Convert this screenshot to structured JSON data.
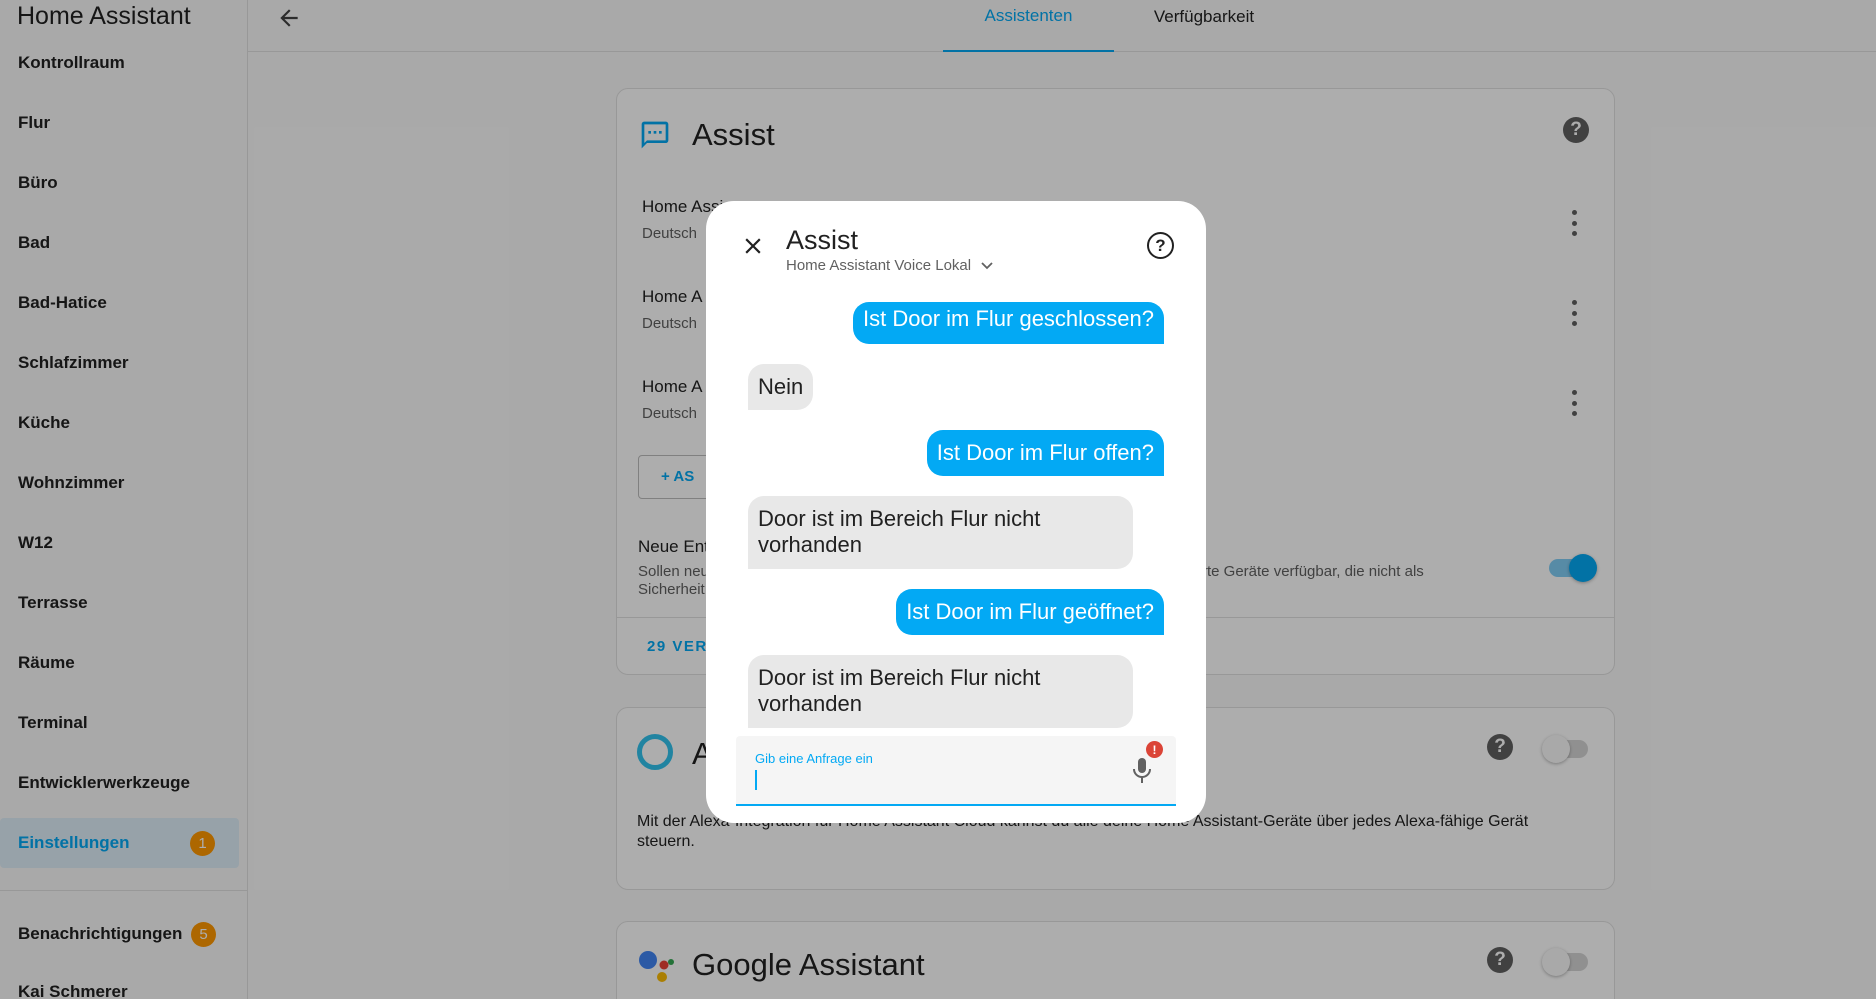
{
  "sidebar": {
    "title": "Home Assistant",
    "items": [
      {
        "label": "Kontrollraum"
      },
      {
        "label": "Flur"
      },
      {
        "label": "Büro"
      },
      {
        "label": "Bad"
      },
      {
        "label": "Bad-Hatice"
      },
      {
        "label": "Schlafzimmer"
      },
      {
        "label": "Küche"
      },
      {
        "label": "Wohnzimmer"
      },
      {
        "label": "W12"
      },
      {
        "label": "Terrasse"
      },
      {
        "label": "Räume"
      },
      {
        "label": "Terminal"
      },
      {
        "label": "Entwicklerwerkzeuge"
      },
      {
        "label": "Einstellungen",
        "badge": "1"
      }
    ],
    "notifications": {
      "label": "Benachrichtigungen",
      "badge": "5"
    },
    "user": {
      "label": "Kai Schmerer"
    }
  },
  "header": {
    "tabs": [
      {
        "label": "Assistenten",
        "active": true
      },
      {
        "label": "Verfügbarkeit",
        "active": false
      }
    ]
  },
  "assist_card": {
    "title": "Assist",
    "pipelines": [
      {
        "title": "Home Assi",
        "language": "Deutsch"
      },
      {
        "title": "Home A",
        "language": "Deutsch"
      },
      {
        "title": "Home A",
        "language": "Deutsch"
      }
    ],
    "add_button": "+   AS",
    "expose_title": "Neue Ent",
    "expose_desc_1": "Sollen neu",
    "expose_desc_1_right": "rte Geräte verfügbar, die nicht als",
    "expose_desc_2": "Sicherheit",
    "exposed_link": "29 VER"
  },
  "alexa_card": {
    "title": "A",
    "description": "Mit der Alexa-Integration für Home Assistant Cloud kannst du alle deine Home Assistant-Geräte über jedes Alexa-fähige Gerät steuern."
  },
  "google_card": {
    "title": "Google Assistant"
  },
  "dialog": {
    "title": "Assist",
    "pipeline": "Home Assistant Voice Lokal",
    "messages": [
      {
        "from": "user",
        "text": "Ist Door im Flur geschlossen?"
      },
      {
        "from": "bot",
        "text": "Nein"
      },
      {
        "from": "user",
        "text": "Ist Door im Flur offen?"
      },
      {
        "from": "bot",
        "text": "Door ist im Bereich Flur nicht vorhanden"
      },
      {
        "from": "user",
        "text": "Ist Door im Flur geöffnet?"
      },
      {
        "from": "bot",
        "text": "Door ist im Bereich Flur nicht vorhanden"
      }
    ],
    "input_placeholder": "Gib eine Anfrage ein",
    "error_badge": "!"
  },
  "colors": {
    "accent": "#03a9f4",
    "badge": "#ff9800",
    "error": "#db4437"
  }
}
